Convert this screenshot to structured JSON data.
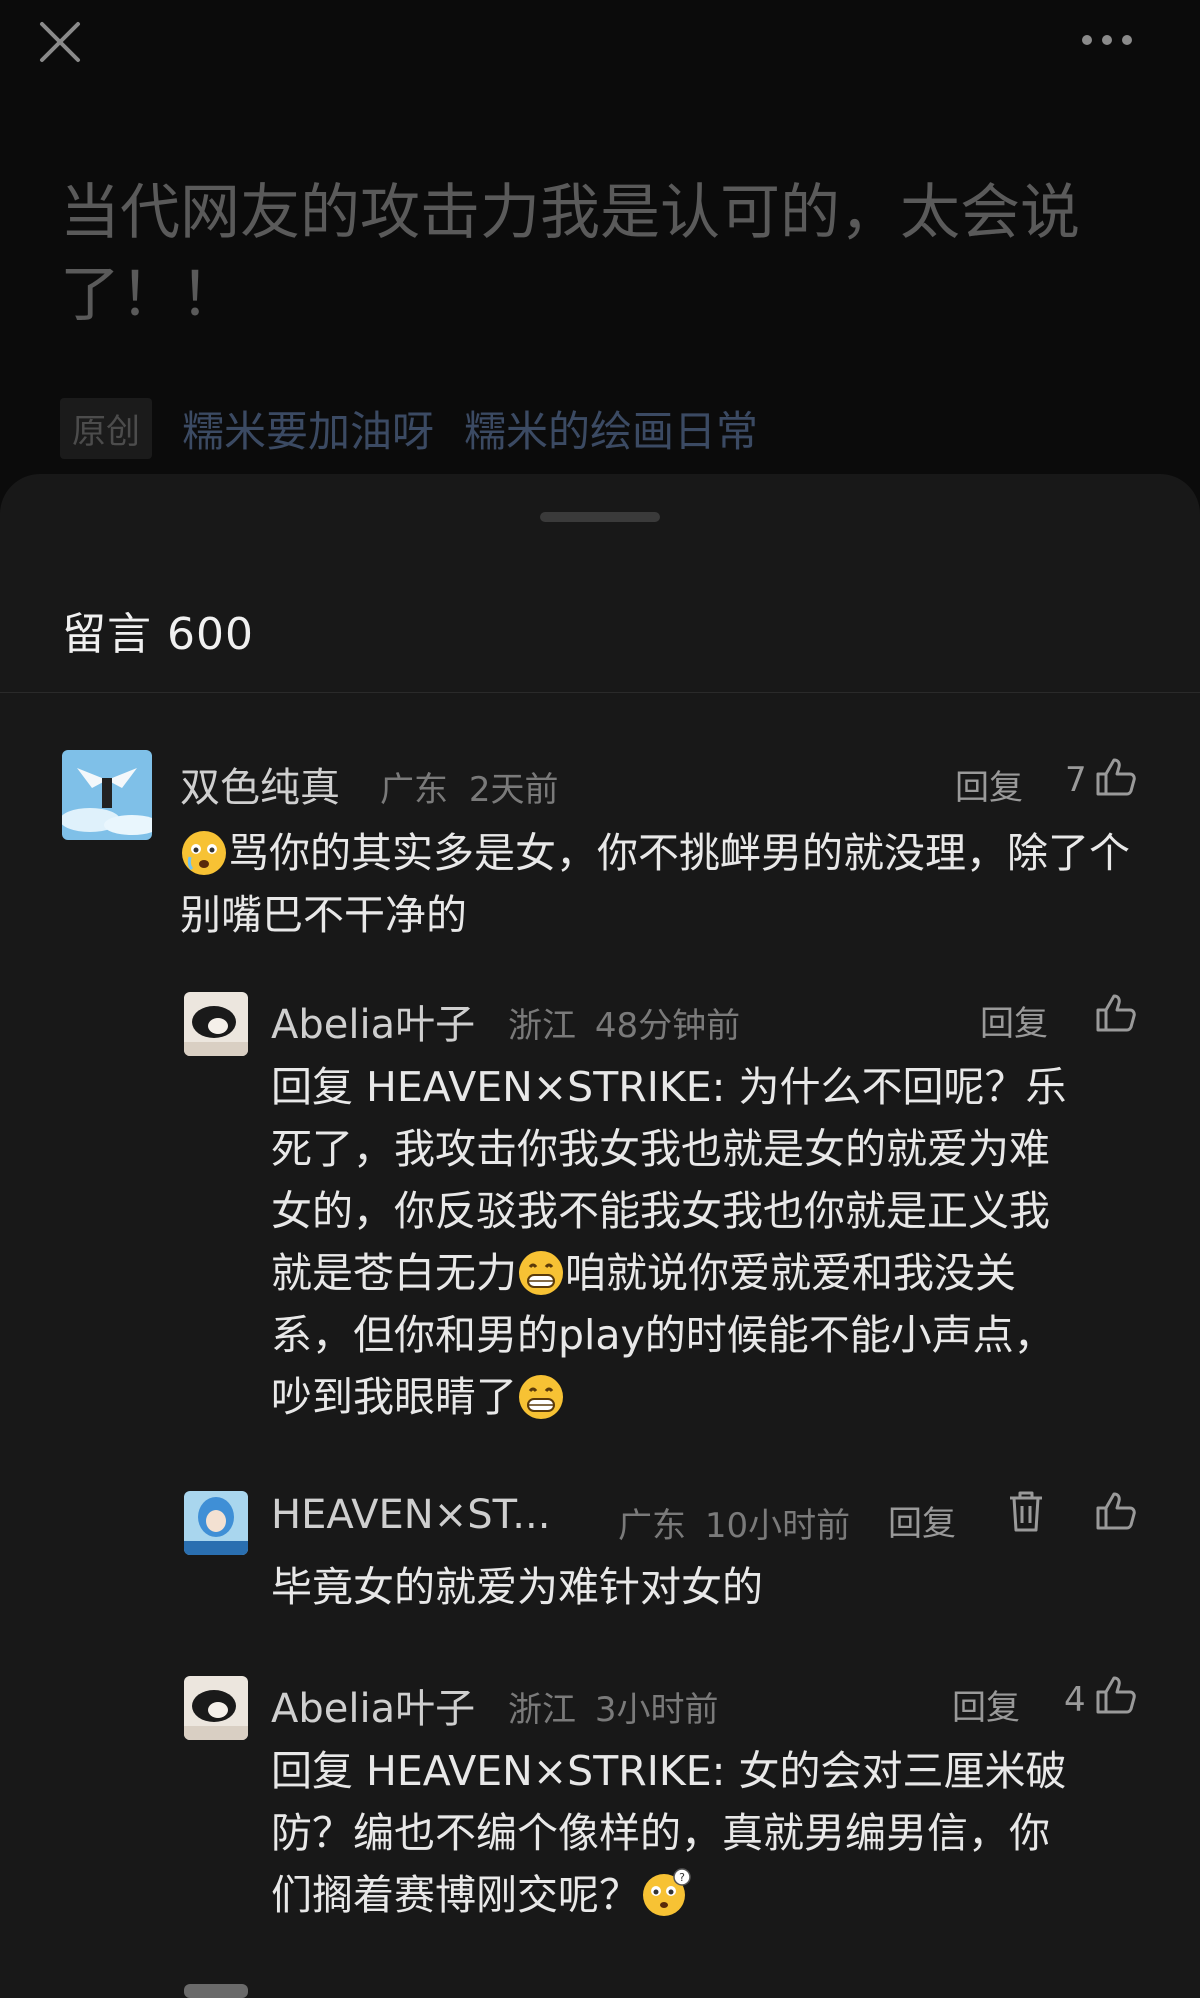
{
  "article": {
    "title": "当代网友的攻击力我是认可的，太会说了！！",
    "badge": "原创",
    "author": "糯米要加油呀",
    "collection": "糯米的绘画日常"
  },
  "comments_sheet": {
    "title": "留言 600"
  },
  "comments": [
    {
      "name": "双色纯真",
      "location": "广东",
      "time": "2天前",
      "reply_label": "回复",
      "likes": "7",
      "text_after_emoji": "骂你的其实多是女，你不挑衅男的就没理，除了个别嘴巴不干净的"
    },
    {
      "name": "Abelia叶子",
      "location": "浙江",
      "time": "48分钟前",
      "reply_label": "回复",
      "likes": "",
      "line1": "回复 HEAVEN×STRIKE: 为什么不回呢？乐",
      "line2": "死了，我攻击你我女我也就是女的就爱为难",
      "line3": "女的，你反驳我不能我女我也你就是正义我",
      "line4a": "就是苍白无力",
      "line4b": "咱就说你爱就爱和我没关",
      "line5": "系，但你和男的play的时候能不能小声点，",
      "line6": "吵到我眼睛了"
    },
    {
      "name": "HEAVEN×ST...",
      "location": "广东",
      "time": "10小时前",
      "reply_label": "回复",
      "likes": "",
      "text": "毕竟女的就爱为难针对女的"
    },
    {
      "name": "Abelia叶子",
      "location": "浙江",
      "time": "3小时前",
      "reply_label": "回复",
      "likes": "4",
      "line1": "回复 HEAVEN×STRIKE: 女的会对三厘米破",
      "line2": "防？编也不编个像样的，真就男编男信，你",
      "line3": "们搁着赛博刚交呢？"
    }
  ],
  "colors": {
    "background": "#0b0b0b",
    "sheet": "#181818",
    "muted_link": "#3b4a63"
  }
}
